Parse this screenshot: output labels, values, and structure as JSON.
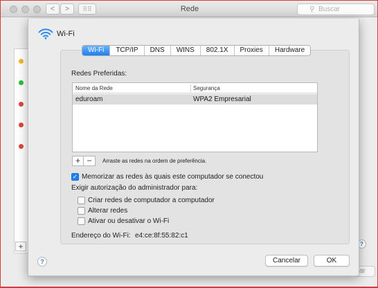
{
  "window": {
    "title": "Rede",
    "search_placeholder": "Buscar",
    "back_glyph": "<",
    "forward_glyph": ">",
    "grid_glyph": "⠿⠿",
    "plus_glyph": "+",
    "help_glyph": "?",
    "partial_button_label": "ar",
    "status_dot_colors": [
      "#f5b52a",
      "#2cc03b",
      "#e0443e",
      "#e0443e",
      "#e0443e"
    ]
  },
  "sheet": {
    "title": "Wi-Fi",
    "wifi_icon": "wifi-icon",
    "accent_color": "#1e7ef2",
    "tabs": [
      {
        "label": "Wi-Fi",
        "active": true
      },
      {
        "label": "TCP/IP",
        "active": false
      },
      {
        "label": "DNS",
        "active": false
      },
      {
        "label": "WINS",
        "active": false
      },
      {
        "label": "802.1X",
        "active": false
      },
      {
        "label": "Proxies",
        "active": false
      },
      {
        "label": "Hardware",
        "active": false
      }
    ],
    "preferred_label": "Redes Preferidas:",
    "table": {
      "columns": [
        "Nome da Rede",
        "Segurança"
      ],
      "rows": [
        {
          "name": "eduroam",
          "security": "WPA2 Empresarial"
        }
      ]
    },
    "add_glyph": "+",
    "remove_glyph": "−",
    "drag_hint": "Arraste as redes na ordem de preferência.",
    "remember_networks": {
      "label": "Memorizar as redes às quais este computador se conectou",
      "checked": true
    },
    "admin_auth_label": "Exigir autorização do administrador para:",
    "admin_options": [
      {
        "label": "Criar redes de computador a computador",
        "checked": false
      },
      {
        "label": "Alterar redes",
        "checked": false
      },
      {
        "label": "Ativar ou desativar o Wi-Fi",
        "checked": false
      }
    ],
    "wifi_address_label": "Endereço do Wi-Fi:",
    "wifi_address_value": "e4:ce:8f:55:82:c1",
    "help_glyph": "?",
    "cancel_label": "Cancelar",
    "ok_label": "OK"
  }
}
